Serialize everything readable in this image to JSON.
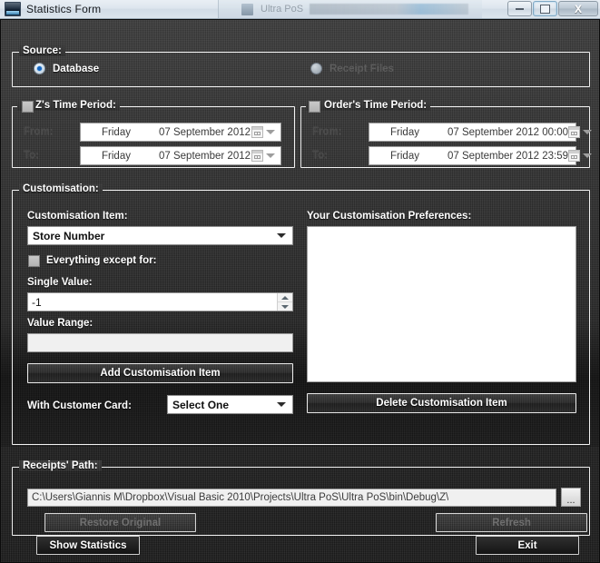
{
  "window": {
    "title": "Statistics Form",
    "minimize_label": "minimize",
    "maximize_label": "maximize",
    "close_label": "X",
    "background_window_title": "Ultra PoS"
  },
  "source_group": {
    "caption": "Source:",
    "options": [
      {
        "label": "Database",
        "selected": true,
        "enabled": true
      },
      {
        "label": "Receipt Files",
        "selected": false,
        "enabled": false
      }
    ]
  },
  "z_time_period": {
    "caption": "Z's Time Period:",
    "checked": false,
    "from_label": "From:",
    "to_label": "To:",
    "from": {
      "day": "Friday",
      "date": "07 September 2012"
    },
    "to": {
      "day": "Friday",
      "date": "07 September 2012"
    }
  },
  "order_time_period": {
    "caption": "Order's Time Period:",
    "checked": false,
    "from_label": "From:",
    "to_label": "To:",
    "from": {
      "day": "Friday",
      "date": "07 September 2012 00:00"
    },
    "to": {
      "day": "Friday",
      "date": "07 September 2012 23:59"
    }
  },
  "customisation": {
    "caption": "Customisation:",
    "item_label": "Customisation Item:",
    "item_value": "Store Number",
    "item_options": [
      "Store Number"
    ],
    "everything_except_label": "Everything except for:",
    "everything_except_checked": false,
    "single_value_label": "Single Value:",
    "single_value": "-1",
    "value_range_label": "Value Range:",
    "value_range": "",
    "add_button": "Add Customisation Item",
    "customer_card_label": "With Customer Card:",
    "customer_card_value": "Select One",
    "customer_card_options": [
      "Select One"
    ],
    "preferences_label": "Your Customisation Preferences:",
    "preferences_items": [],
    "delete_button": "Delete Customisation Item"
  },
  "receipts_path": {
    "caption": "Receipts' Path:",
    "path": "C:\\Users\\Giannis M\\Dropbox\\Visual Basic 2010\\Projects\\Ultra PoS\\Ultra PoS\\bin\\Debug\\Z\\",
    "browse_label": "...",
    "restore_button": "Restore Original",
    "restore_enabled": false,
    "refresh_button": "Refresh",
    "refresh_enabled": false
  },
  "footer": {
    "show_statistics": "Show Statistics",
    "exit": "Exit"
  },
  "colors": {
    "accent": "#1565c0",
    "border": "#f2f2f2",
    "background": "#2c2c2c",
    "text": "#ffffff",
    "disabled_text": "#6f6f6f"
  }
}
